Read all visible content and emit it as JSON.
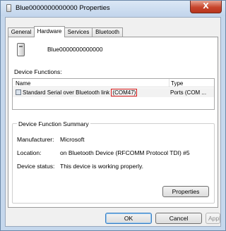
{
  "window": {
    "title": "Blue0000000000000 Properties",
    "close_label": "X"
  },
  "tabs": [
    {
      "label": "General",
      "active": false
    },
    {
      "label": "Hardware",
      "active": true
    },
    {
      "label": "Services",
      "active": false
    },
    {
      "label": "Bluetooth",
      "active": false
    }
  ],
  "device": {
    "name": "Blue0000000000000",
    "icon": "device-icon"
  },
  "functions": {
    "heading": "Device Functions:",
    "columns": [
      "Name",
      "Type"
    ],
    "rows": [
      {
        "name": "Standard Serial over Bluetooth link",
        "port": "(COM47)",
        "type": "Ports (COM ..."
      }
    ]
  },
  "summary": {
    "title": "Device Function Summary",
    "manufacturer_label": "Manufacturer:",
    "manufacturer": "Microsoft",
    "location_label": "Location:",
    "location": "on Bluetooth Device (RFCOMM Protocol TDI) #5",
    "status_label": "Device status:",
    "status": "This device is working properly.",
    "properties_button": "Properties"
  },
  "footer": {
    "ok": "OK",
    "cancel": "Cancel",
    "apply": "Apply"
  },
  "colors": {
    "highlight_box": "#d81c1c",
    "close_button": "#c7452c"
  }
}
